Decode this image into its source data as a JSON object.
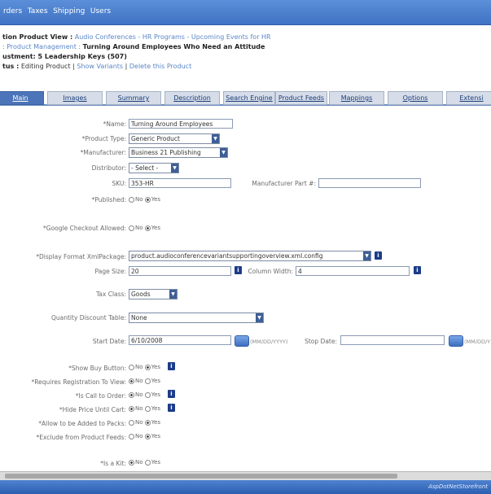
{
  "topnav": {
    "items": [
      "rders",
      "Taxes",
      "Shipping",
      "Users"
    ]
  },
  "breadcrumb": {
    "line1_bold": "tion Product View :",
    "line1_links": "Audio Conferences - HR Programs - Upcoming Events for HR",
    "line2_link": ": Product Management :",
    "line2_bold": "Turning Around Employees Who Need an Attitude",
    "line3_bold": "ustment: 5 Leadership Keys (507)",
    "line4_bold": "tus :",
    "line4_text": "Editing Product |",
    "line4_link1": "Show Variants",
    "line4_sep": "|",
    "line4_link2": "Delete this Product"
  },
  "tabs": [
    "Main",
    "Images",
    "Summary",
    "Description",
    "Search Engine",
    "Product Feeds",
    "Mappings",
    "Options",
    "Extensi"
  ],
  "form": {
    "name_label": "*Name:",
    "name_value": "Turning Around Employees",
    "ptype_label": "*Product Type:",
    "ptype_value": "Generic Product",
    "mfr_label": "*Manufacturer:",
    "mfr_value": "Business 21 Publishing",
    "dist_label": "Distributor:",
    "dist_value": "- Select -",
    "sku_label": "SKU:",
    "sku_value": "353-HR",
    "mpn_label": "Manufacturer Part #:",
    "mpn_value": "",
    "published_label": "*Published:",
    "google_label": "*Google Checkout Allowed:",
    "xml_label": "*Display Format XmlPackage:",
    "xml_value": "product.audioconferencevariantsupportingoverview.xml.config",
    "pagesize_label": "Page Size:",
    "pagesize_value": "20",
    "colwidth_label": "Column Width:",
    "colwidth_value": "4",
    "tax_label": "Tax Class:",
    "tax_value": "Goods",
    "qdt_label": "Quantity Discount Table:",
    "qdt_value": "None",
    "start_label": "Start Date:",
    "start_value": "6/10/2008",
    "start_hint": "(MM/DD/YYYY)",
    "stop_label": "Stop Date:",
    "stop_value": "",
    "stop_hint": "(MM/DD/Y",
    "showbuy_label": "*Show Buy Button:",
    "reqreg_label": "*Requires Registration To View:",
    "callorder_label": "*Is Call to Order:",
    "hideprice_label": "*Hide Price Until Cart:",
    "packs_label": "*Allow to be Added to Packs:",
    "exclude_label": "*Exclude from Product Feeds:",
    "kit_label": "*Is a Kit:",
    "no": "No",
    "yes": "Yes"
  },
  "footer": {
    "brand": "AspDotNetStorefront"
  },
  "colors": {
    "nav": "#3f73c4",
    "tab_active": "#4c74b8",
    "info": "#1c3c8a"
  }
}
